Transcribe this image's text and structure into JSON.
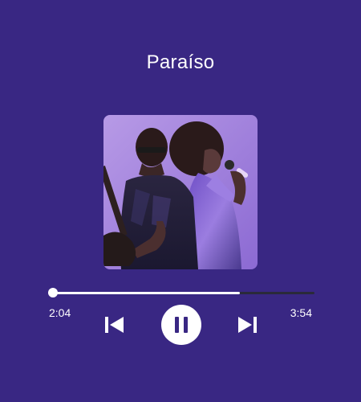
{
  "track": {
    "title": "Paraíso"
  },
  "album_art": {
    "description": "two performers with guitar and microphone",
    "icon": "album-art-photo"
  },
  "progress": {
    "fraction": 0.72,
    "current_time": "2:04",
    "total_time": "3:54"
  },
  "controls": {
    "previous_icon": "skip-previous-icon",
    "pause_icon": "pause-icon",
    "next_icon": "skip-next-icon"
  },
  "colors": {
    "background": "#392783",
    "accent": "#ffffff",
    "track_empty": "#2a2a3a"
  }
}
